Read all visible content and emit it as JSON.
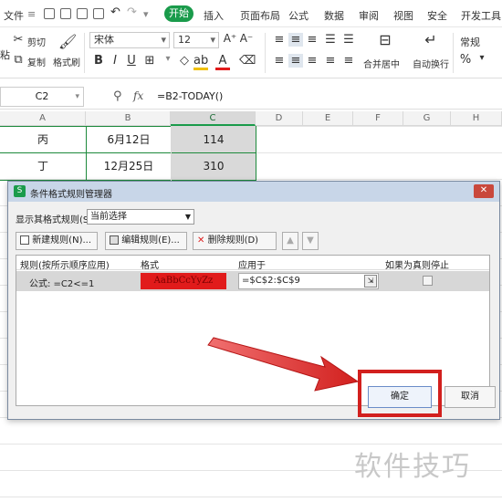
{
  "menu": {
    "file": "文件",
    "tabs": [
      "开始",
      "插入",
      "页面布局",
      "公式",
      "数据",
      "审阅",
      "视图",
      "安全",
      "开发工具"
    ]
  },
  "ribbon": {
    "cut": "剪切",
    "copy": "复制",
    "format_painter": "格式刷",
    "paste_icon_label": "粘",
    "font_name": "宋体",
    "font_size": "12",
    "merge_center": "合并居中",
    "auto_wrap": "自动换行",
    "number_format": "常规",
    "font_grow": "A⁺",
    "font_shrink": "A⁻"
  },
  "formula_bar": {
    "cell_ref": "C2",
    "fx": "fx",
    "formula": "=B2-TODAY()"
  },
  "columns": [
    "A",
    "B",
    "C",
    "D",
    "E",
    "F",
    "G",
    "H"
  ],
  "rows": [
    {
      "a": "丙",
      "b": "6月12日",
      "c": "114"
    },
    {
      "a": "丁",
      "b": "12月25日",
      "c": "310"
    }
  ],
  "dialog": {
    "title": "条件格式规则管理器",
    "show_rules_label": "显示其格式规则(S):",
    "show_rules_value": "当前选择",
    "new_rule": "新建规则(N)...",
    "edit_rule": "编辑规则(E)...",
    "delete_rule": "删除规则(D)",
    "col_rule": "规则(按所示顺序应用)",
    "col_format": "格式",
    "col_applies": "应用于",
    "col_stop": "如果为真则停止",
    "rule_text": "公式: =C2<=1",
    "format_preview": "AaBbCcYyZz",
    "applies_to": "=$C$2:$C$9",
    "ok": "确定",
    "cancel": "取消"
  },
  "colors": {
    "brand_green": "#1a9b4b",
    "highlight_red": "#e11b1b",
    "dialog_bg": "#f0f0f0"
  },
  "watermark": "软件技巧"
}
